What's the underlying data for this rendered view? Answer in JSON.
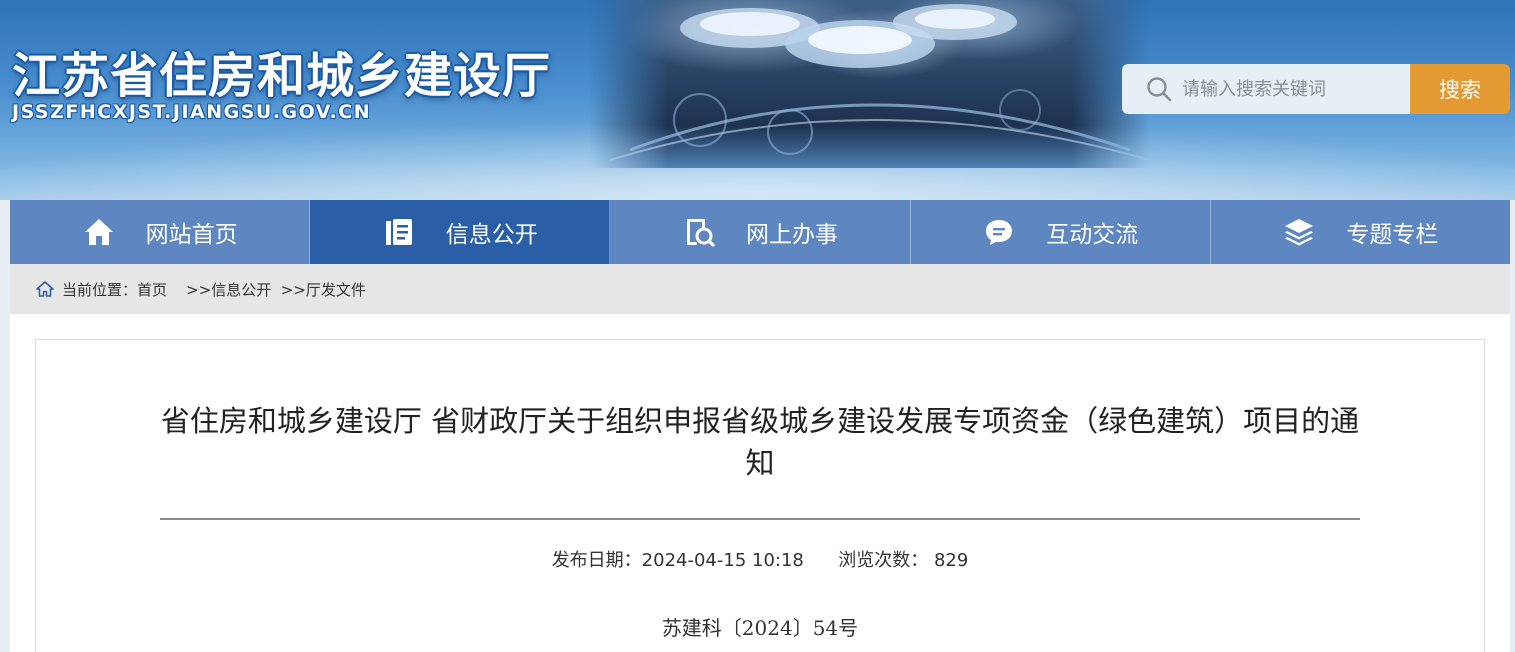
{
  "header": {
    "site_title": "江苏省住房和城乡建设厅",
    "site_domain": "JSSZFHCXJST.JIANGSU.GOV.CN",
    "search_placeholder": "请输入搜索关键词",
    "search_button": "搜索",
    "search_icon": "search-icon"
  },
  "nav": {
    "items": [
      {
        "label": "网站首页",
        "icon": "home-icon",
        "active": false
      },
      {
        "label": "信息公开",
        "icon": "document-icon",
        "active": true
      },
      {
        "label": "网上办事",
        "icon": "search-document-icon",
        "active": false
      },
      {
        "label": "互动交流",
        "icon": "chat-bubble-icon",
        "active": false
      },
      {
        "label": "专题专栏",
        "icon": "layers-icon",
        "active": false
      }
    ],
    "bg_color": "#5e86c0",
    "active_color": "#2a5fa8"
  },
  "breadcrumb": {
    "prefix": "当前位置：",
    "items": [
      "首页",
      ">>信息公开",
      ">>厅发文件"
    ]
  },
  "article": {
    "title": "省住房和城乡建设厅 省财政厅关于组织申报省级城乡建设发展专项资金（绿色建筑）项目的通知",
    "publish_label": "发布日期：",
    "publish_date": "2024-04-15 10:18",
    "views_label": "浏览次数：",
    "views": "829",
    "doc_number": "苏建科〔2024〕54号"
  },
  "colors": {
    "accent": "#e39a33",
    "header_blue": "#2f73b8"
  }
}
